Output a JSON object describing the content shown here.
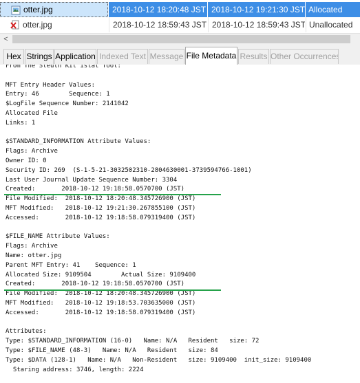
{
  "file_table": {
    "rows": [
      {
        "name": "otter.jpg",
        "modified": "2018-10-12 18:20:48 JST",
        "changed": "2018-10-12 19:21:30 JST",
        "status": "Allocated"
      },
      {
        "name": "otter.jpg",
        "modified": "2018-10-12 18:59:43 JST",
        "changed": "2018-10-12 18:59:43 JST",
        "status": "Unallocated"
      }
    ]
  },
  "scrollbar": {
    "left_arrow": "<"
  },
  "tabs": [
    {
      "label": "Hex",
      "state": "normal"
    },
    {
      "label": "Strings",
      "state": "normal"
    },
    {
      "label": "Application",
      "state": "normal"
    },
    {
      "label": "Indexed Text",
      "state": "disabled"
    },
    {
      "label": "Message",
      "state": "disabled"
    },
    {
      "label": "File Metadata",
      "state": "active"
    },
    {
      "label": "Results",
      "state": "disabled"
    },
    {
      "label": "Other Occurrences",
      "state": "disabled"
    }
  ],
  "metadata_lines": [
    "From The Sleuth Kit istat Tool:",
    "",
    "MFT Entry Header Values:",
    "Entry: 46        Sequence: 1",
    "$LogFile Sequence Number: 2141042",
    "Allocated File",
    "Links: 1",
    "",
    "$STANDARD_INFORMATION Attribute Values:",
    "Flags: Archive",
    "Owner ID: 0",
    "Security ID: 269  (S-1-5-21-3032502310-2804630001-3739594766-1001)",
    "Last User Journal Update Sequence Number: 3304",
    "Created:       2018-10-12 19:18:58.0570700 (JST)",
    "File Modified:  2018-10-12 18:20:48.345726900 (JST)",
    "MFT Modified:   2018-10-12 19:21:30.267855100 (JST)",
    "Accessed:       2018-10-12 19:18:58.079319400 (JST)",
    "",
    "$FILE_NAME Attribute Values:",
    "Flags: Archive",
    "Name: otter.jpg",
    "Parent MFT Entry: 41    Sequence: 1",
    "Allocated Size: 9109504        Actual Size: 9109400",
    "Created:       2018-10-12 19:18:58.0570700 (JST)",
    "File Modified:  2018-10-12 18:20:48.345726900 (JST)",
    "MFT Modified:   2018-10-12 19:18:53.703635000 (JST)",
    "Accessed:       2018-10-12 19:18:58.079319400 (JST)",
    "",
    "Attributes:",
    "Type: $STANDARD_INFORMATION (16-0)   Name: N/A   Resident   size: 72",
    "Type: $FILE_NAME (48-3)   Name: N/A   Resident   size: 84",
    "Type: $DATA (128-1)   Name: N/A   Non-Resident   size: 9109400  init_size: 9109400",
    "  Staring address: 3746, length: 2224"
  ],
  "colors": {
    "selection": "#3d8ee6",
    "highlight_underline": "#25a24a",
    "unallocated_icon": "#d42020"
  }
}
